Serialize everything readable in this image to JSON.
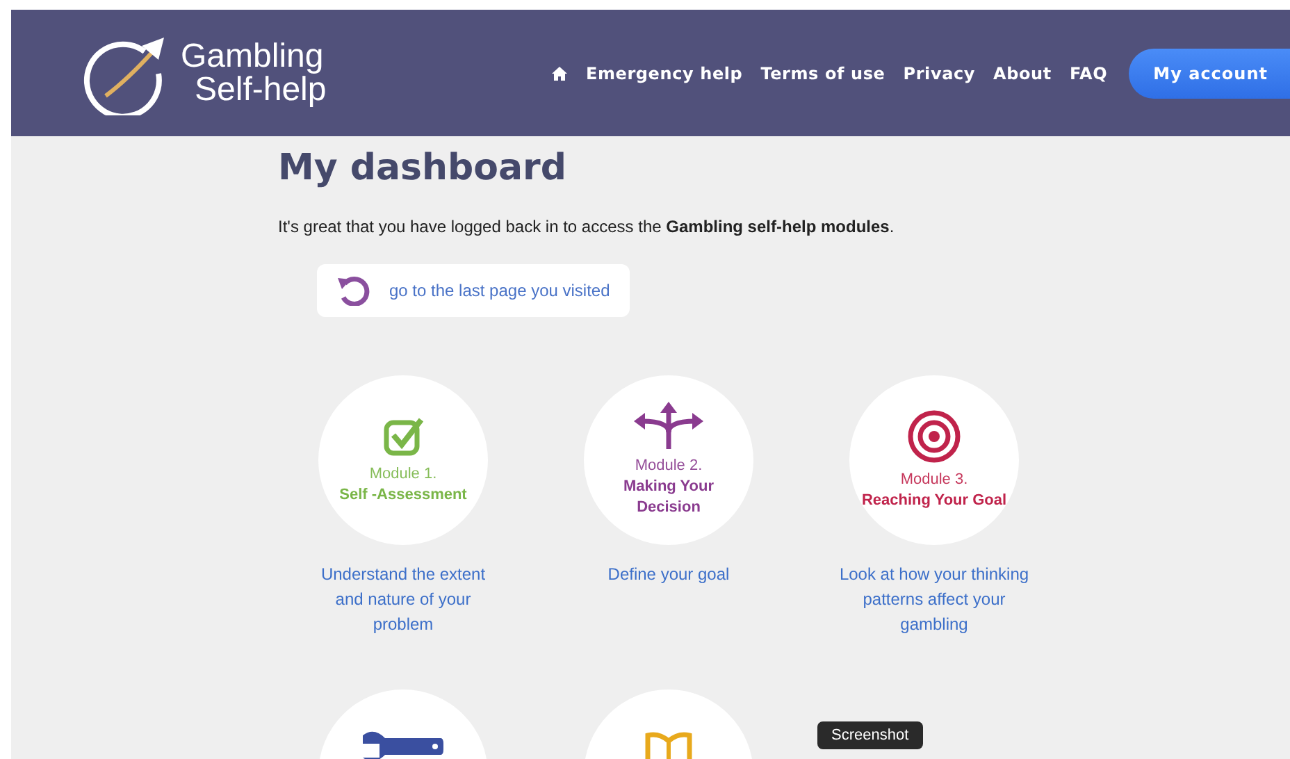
{
  "header": {
    "logo_line_1": "Gambling",
    "logo_line_2": "Self-help",
    "nav": [
      "Emergency help",
      "Terms of use",
      "Privacy",
      "About",
      "FAQ"
    ],
    "account_button": "My account"
  },
  "title": "My dashboard",
  "intro": "It's great that you have logged back in to access the **Gambling self-help modules**.",
  "last_page_link": "go to the last page you visited",
  "modules": [
    {
      "kind": "check",
      "color": "#7ab648",
      "number": "Module 1.",
      "name": "Self -Assessment",
      "description": "Understand the extent and nature of your problem"
    },
    {
      "kind": "arrows",
      "color": "#8a3b8f",
      "number": "Module 2.",
      "name": "Making Your Decision",
      "description": "Define your goal"
    },
    {
      "kind": "target",
      "color": "#c0234b",
      "number": "Module 3.",
      "name": "Reaching Your Goal",
      "description": "Look at how your thinking patterns affect your gambling"
    },
    {
      "kind": "wrench",
      "color": "#3a4fa0"
    },
    {
      "kind": "book",
      "color": "#e8a91c"
    }
  ],
  "tooltip": "Screenshot"
}
